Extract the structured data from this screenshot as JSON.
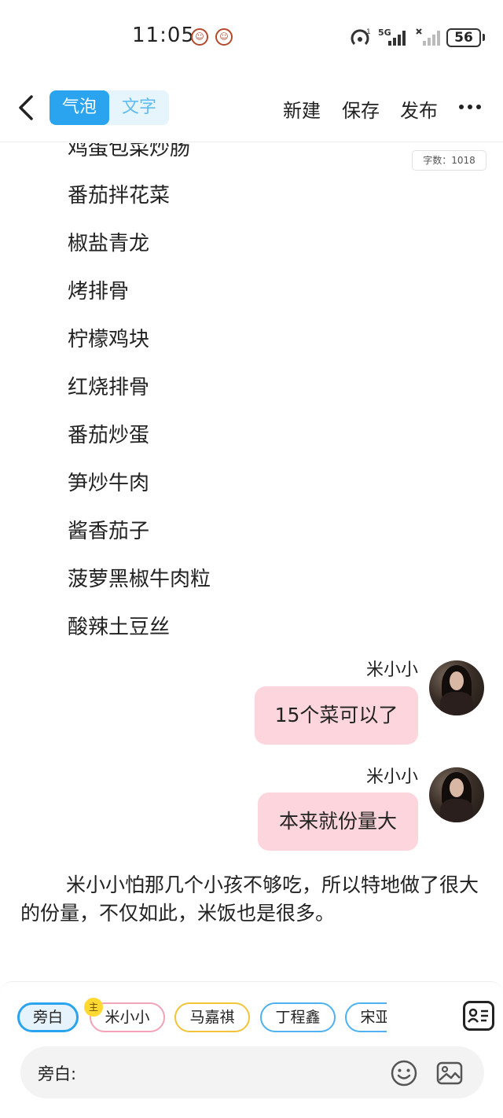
{
  "status_bar": {
    "time": "11:05",
    "network": "5G",
    "battery": "56"
  },
  "header": {
    "mode_bubble": "气泡",
    "mode_text": "文字",
    "new_label": "新建",
    "save_label": "保存",
    "publish_label": "发布"
  },
  "content": {
    "word_count": "字数：1018",
    "partial_top_item": "鸡蛋包菜炒肠",
    "dishes": [
      "番茄拌花菜",
      "椒盐青龙",
      "烤排骨",
      "柠檬鸡块",
      "红烧排骨",
      "番茄炒蛋",
      "笋炒牛肉",
      "酱香茄子",
      "菠萝黑椒牛肉粒",
      "酸辣土豆丝"
    ],
    "messages": [
      {
        "name": "米小小",
        "text": "15个菜可以了"
      },
      {
        "name": "米小小",
        "text": "本来就份量大"
      }
    ],
    "narration": "米小小怕那几个小孩不够吃，所以特地做了很大的份量，不仅如此，米饭也是很多。"
  },
  "bottom": {
    "host_badge": "主",
    "roles": [
      {
        "label": "旁白",
        "color": "#2aa4ee"
      },
      {
        "label": "米小小",
        "color": "#f2a3b8"
      },
      {
        "label": "马嘉祺",
        "color": "#f2c438"
      },
      {
        "label": "丁程鑫",
        "color": "#4db2ee"
      },
      {
        "label": "宋亚轩",
        "color": "#4db2ee"
      }
    ],
    "input_prefix": "旁白:"
  },
  "colors": {
    "accent": "#2aa4ee",
    "bubble_pink": "#fdd5dc"
  }
}
